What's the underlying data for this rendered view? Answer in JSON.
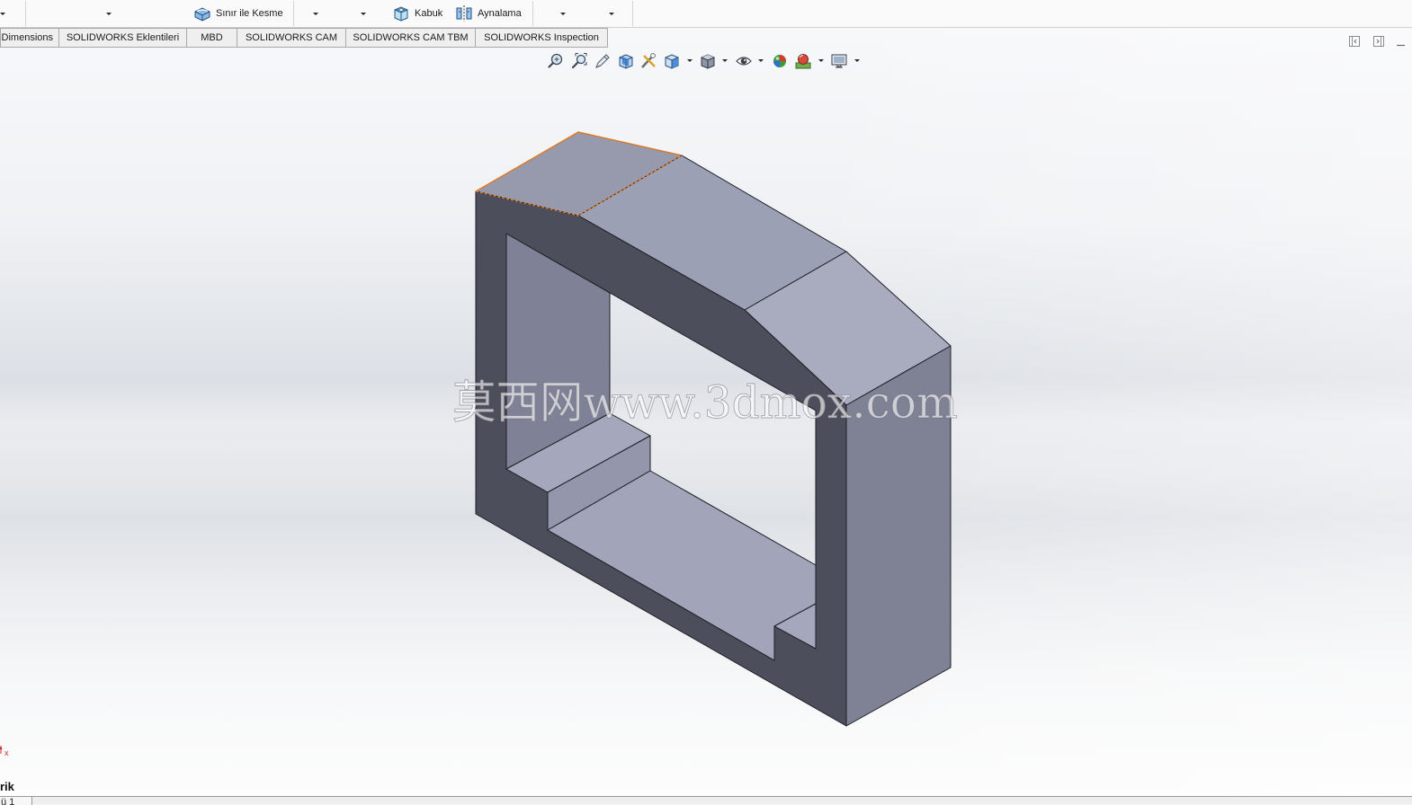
{
  "toolbar": {
    "boundary_cut": {
      "label": "Sınır ile Kesme",
      "icon": "boundary-cut-icon"
    },
    "shell": {
      "label": "Kabuk",
      "icon": "shell-icon"
    },
    "mirror": {
      "label": "Aynalama",
      "icon": "mirror-icon"
    }
  },
  "command_tabs": [
    {
      "label": "Dimensions"
    },
    {
      "label": "SOLIDWORKS Eklentileri"
    },
    {
      "label": "MBD"
    },
    {
      "label": "SOLIDWORKS CAM"
    },
    {
      "label": "SOLIDWORKS CAM TBM"
    },
    {
      "label": "SOLIDWORKS Inspection"
    }
  ],
  "heads_up_view_toolbar": [
    {
      "icon": "zoom-to-fit-icon"
    },
    {
      "icon": "zoom-to-area-icon"
    },
    {
      "icon": "previous-view-icon"
    },
    {
      "icon": "section-view-icon"
    },
    {
      "icon": "dynamic-annotation-views-icon"
    },
    {
      "icon": "view-orientation-icon",
      "has_dropdown": true
    },
    {
      "icon": "display-style-icon",
      "has_dropdown": true
    },
    {
      "icon": "hide-show-items-icon",
      "has_dropdown": true
    },
    {
      "icon": "edit-appearance-icon"
    },
    {
      "icon": "apply-scene-icon",
      "has_dropdown": true
    },
    {
      "icon": "view-settings-icon",
      "has_dropdown": true
    }
  ],
  "window_controls": [
    {
      "icon": "panel-left-icon"
    },
    {
      "icon": "panel-right-icon"
    },
    {
      "icon": "minimize-icon"
    }
  ],
  "viewport": {
    "watermark": "莫西网www.3dmox.com",
    "triad_axis_label": "x",
    "colors": {
      "selected_edge": "#e27b22",
      "model_edge": "#1e1f26",
      "front_face": "#4c4e5b",
      "right_face": "#7f8195",
      "top_face": "#9ca0b5",
      "chamfer_face_left": "#9799ad",
      "chamfer_face_right": "#a9abbf",
      "inner_wall": "#7f8296",
      "step_top": "#a5a8bc",
      "step_riser": "#9497ab",
      "floor": "#a2a5ba"
    }
  },
  "status": {
    "feature_label": "rik",
    "sheet_tab": "ü 1"
  }
}
